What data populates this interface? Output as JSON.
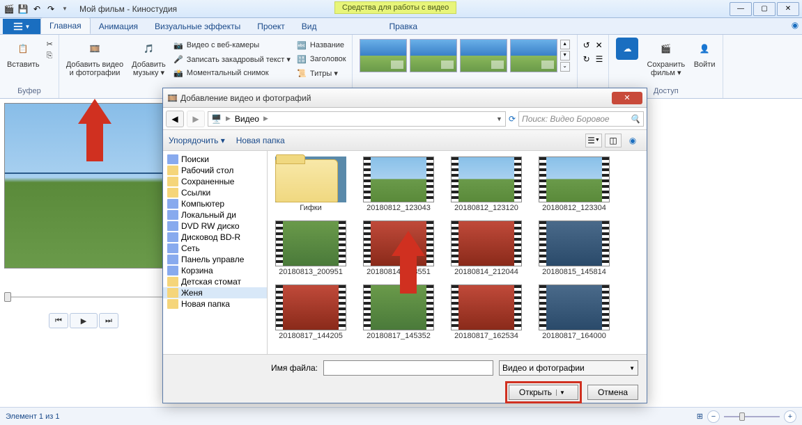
{
  "window": {
    "title": "Мой фильм - Киностудия",
    "context_tab": "Средства для работы с видео"
  },
  "tabs": {
    "file_icon": "menu",
    "main": "Главная",
    "animation": "Анимация",
    "effects": "Визуальные эффекты",
    "project": "Проект",
    "view": "Вид",
    "edit": "Правка"
  },
  "ribbon": {
    "clipboard": {
      "paste": "Вставить",
      "group_label": "Буфер"
    },
    "add": {
      "add_video": "Добавить видео\nи фотографии",
      "add_music": "Добавить\nмузыку ▾"
    },
    "small": {
      "webcam": "Видео с веб-камеры",
      "voiceover": "Записать закадровый текст ▾",
      "snapshot": "Моментальный снимок"
    },
    "labels": {
      "title": "Название",
      "heading": "Заголовок",
      "credits": "Титры ▾"
    },
    "share": {
      "save_movie": "Сохранить\nфильм ▾",
      "signin": "Войти",
      "group_label": "Доступ"
    }
  },
  "dialog": {
    "title": "Добавление видео и фотографий",
    "breadcrumb": {
      "root_icon": "computer",
      "item": "Видео"
    },
    "search_placeholder": "Поиск: Видео Боровое",
    "toolbar": {
      "organize": "Упорядочить ▾",
      "new_folder": "Новая папка"
    },
    "tree": [
      {
        "label": "Поиски",
        "icon": "sys"
      },
      {
        "label": "Рабочий стол",
        "icon": "folder"
      },
      {
        "label": "Сохраненные",
        "icon": "folder"
      },
      {
        "label": "Ссылки",
        "icon": "folder"
      },
      {
        "label": "Компьютер",
        "icon": "sys"
      },
      {
        "label": "Локальный ди",
        "icon": "sys"
      },
      {
        "label": "DVD RW диско",
        "icon": "sys"
      },
      {
        "label": "Дисковод BD-R",
        "icon": "sys"
      },
      {
        "label": "Сеть",
        "icon": "sys"
      },
      {
        "label": "Панель управле",
        "icon": "sys"
      },
      {
        "label": "Корзина",
        "icon": "sys"
      },
      {
        "label": "Детская стомат",
        "icon": "folder"
      },
      {
        "label": "Женя",
        "icon": "folder",
        "selected": true
      },
      {
        "label": "Новая папка",
        "icon": "folder"
      }
    ],
    "files": [
      {
        "label": "Гифки",
        "type": "folder"
      },
      {
        "label": "20180812_123043",
        "type": "video",
        "thumb": "sky"
      },
      {
        "label": "20180812_123120",
        "type": "video",
        "thumb": "sky"
      },
      {
        "label": "20180812_123304",
        "type": "video",
        "thumb": "sky"
      },
      {
        "label": "20180813_200951",
        "type": "video",
        "thumb": "grass"
      },
      {
        "label": "20180814_103551",
        "type": "video",
        "thumb": "red"
      },
      {
        "label": "20180814_212044",
        "type": "video",
        "thumb": "red"
      },
      {
        "label": "20180815_145814",
        "type": "video",
        "thumb": "water"
      },
      {
        "label": "20180817_144205",
        "type": "video",
        "thumb": "red"
      },
      {
        "label": "20180817_145352",
        "type": "video",
        "thumb": "grass"
      },
      {
        "label": "20180817_162534",
        "type": "video",
        "thumb": "red"
      },
      {
        "label": "20180817_164000",
        "type": "video",
        "thumb": "water"
      }
    ],
    "footer": {
      "filename_label": "Имя файла:",
      "filter": "Видео и фотографии",
      "open": "Открыть",
      "cancel": "Отмена"
    }
  },
  "statusbar": {
    "element_info": "Элемент 1 из 1"
  }
}
